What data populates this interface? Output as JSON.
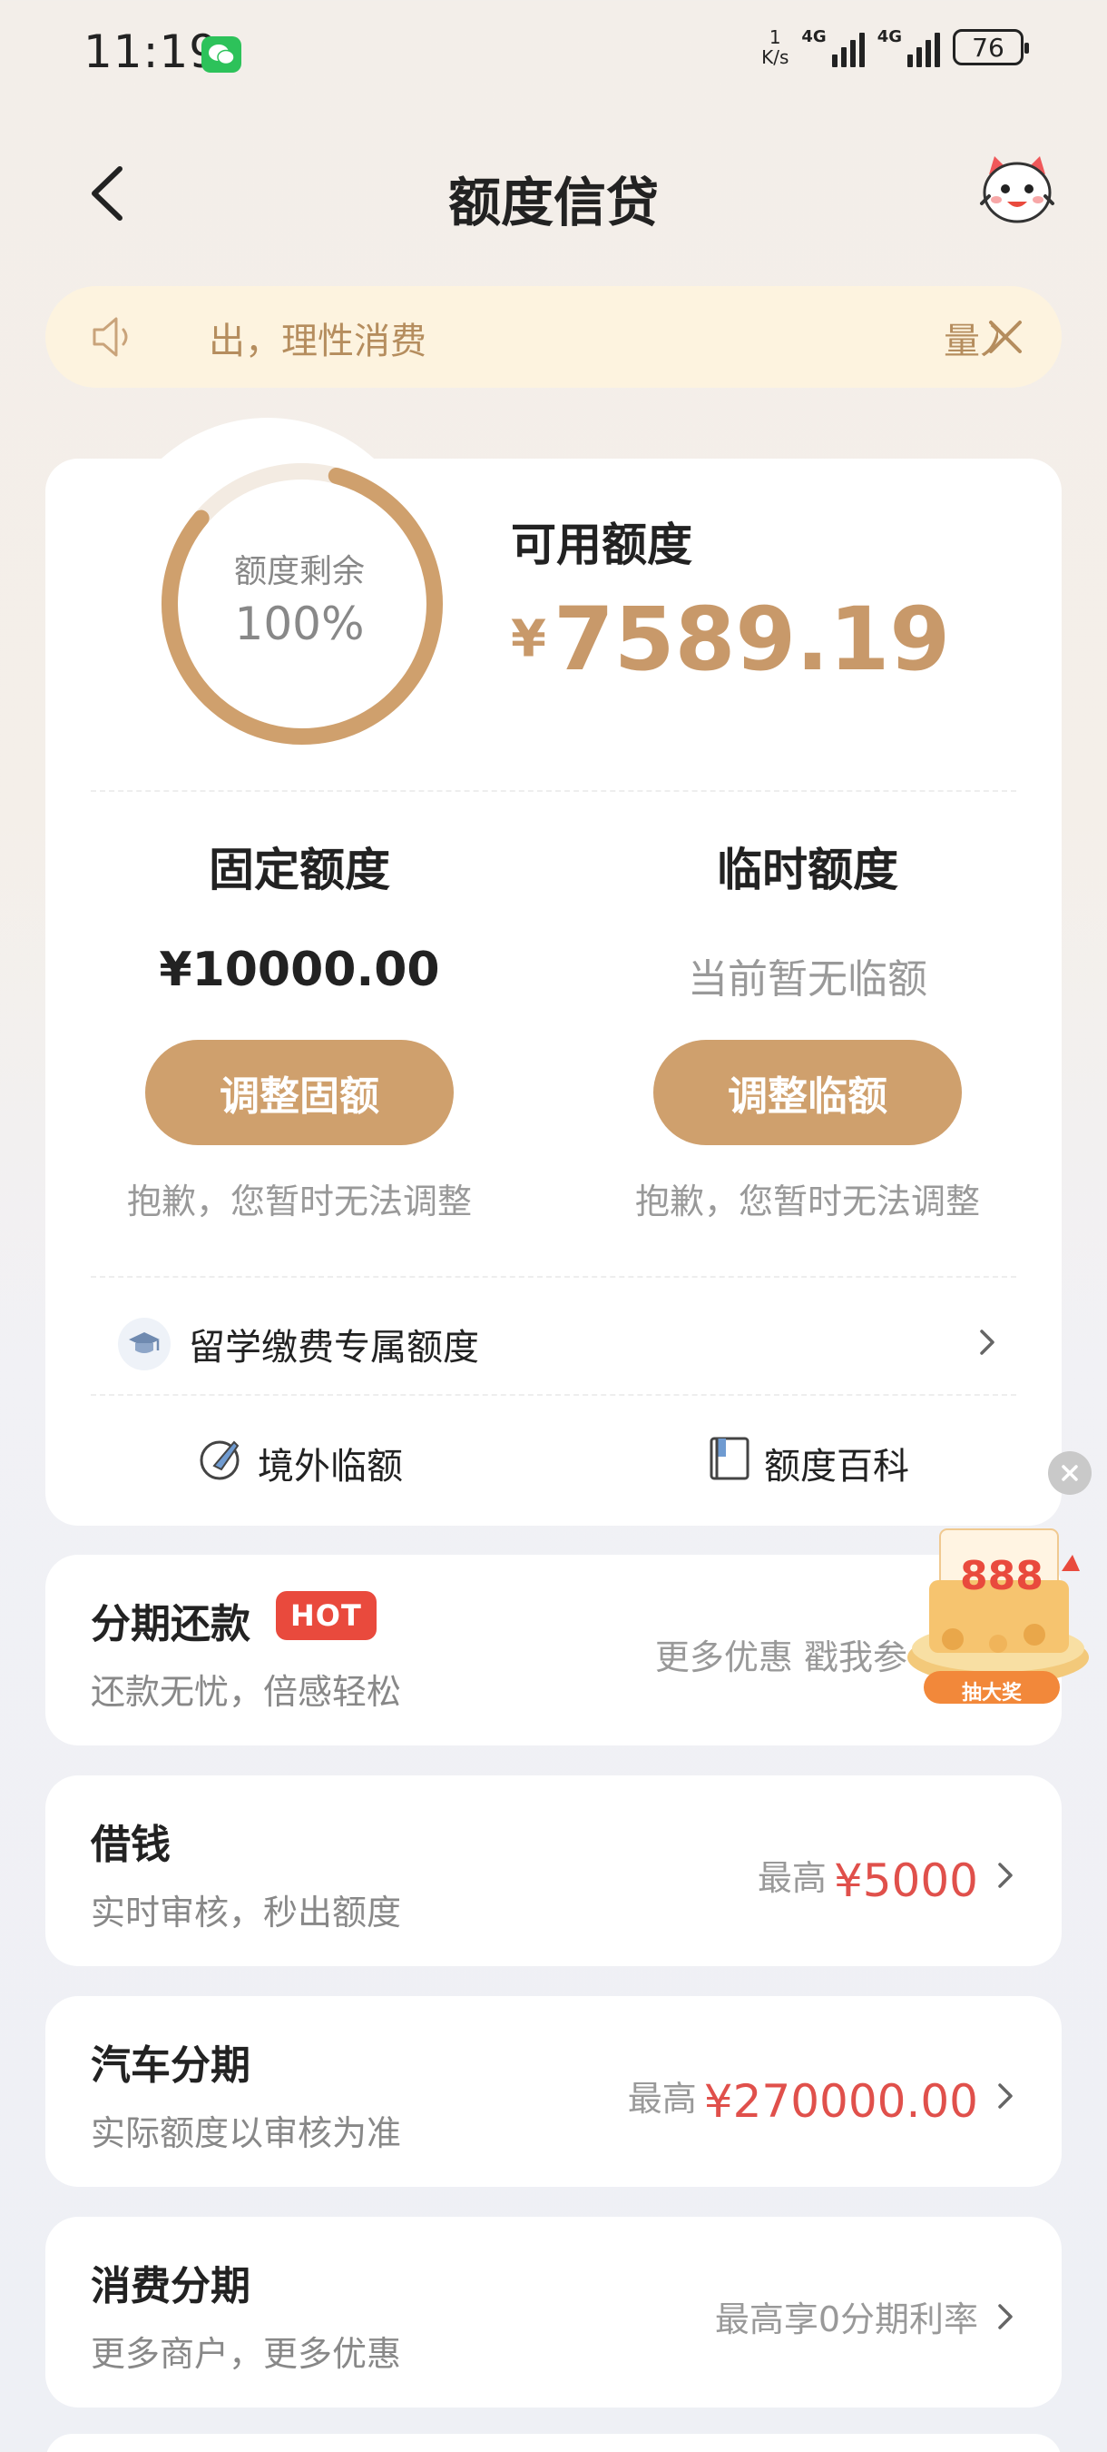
{
  "status_bar": {
    "time": "11:19",
    "net_speed_value": "1",
    "net_speed_unit": "K/s",
    "network_1": "4G",
    "network_2": "4G",
    "battery": "76"
  },
  "header": {
    "title": "额度信贷"
  },
  "notice": {
    "text": "出，理性消费",
    "right_text": "量入"
  },
  "quota": {
    "ring_label": "额度剩余",
    "ring_value": "100%",
    "ring_fraction": 0.82,
    "available_label": "可用额度",
    "currency": "¥",
    "available_value": "7589.19",
    "fixed": {
      "title": "固定额度",
      "value": "¥10000.00",
      "button": "调整固额",
      "note": "抱歉，您暂时无法调整"
    },
    "temporary": {
      "title": "临时额度",
      "value": "当前暂无临额",
      "button": "调整临额",
      "note": "抱歉，您暂时无法调整"
    },
    "study_abroad": "留学缴费专属额度",
    "shortcut_overseas": "境外临额",
    "shortcut_wiki": "额度百科"
  },
  "products": [
    {
      "name": "分期还款",
      "badge": "HOT",
      "sub": "还款无忧，倍感轻松",
      "right_prefix": "更多优惠 戳我参",
      "right_highlight": ""
    },
    {
      "name": "借钱",
      "sub": "实时审核，秒出额度",
      "right_prefix": "最高",
      "right_highlight": "¥5000"
    },
    {
      "name": "汽车分期",
      "sub": "实际额度以审核为准",
      "right_prefix": "最高",
      "right_highlight": "¥270000.00"
    },
    {
      "name": "消费分期",
      "sub": "更多商户，更多优惠",
      "right_prefix": "最高享0分期利率",
      "right_highlight": ""
    }
  ],
  "promo": {
    "amount": "888",
    "button": "抽大奖"
  },
  "colors": {
    "accent": "#cfa06d",
    "highlight_red": "#e0504b",
    "notice_bg": "#fdf3df"
  }
}
